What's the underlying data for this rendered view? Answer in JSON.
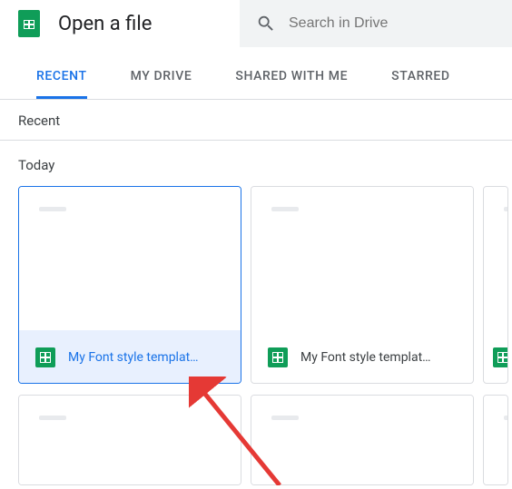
{
  "header": {
    "title": "Open a file",
    "search": {
      "placeholder": "Search in Drive",
      "value": ""
    }
  },
  "tabs": {
    "items": [
      {
        "label": "RECENT",
        "active": true
      },
      {
        "label": "MY DRIVE",
        "active": false
      },
      {
        "label": "SHARED WITH ME",
        "active": false
      },
      {
        "label": "STARRED",
        "active": false
      }
    ]
  },
  "section": {
    "label": "Recent"
  },
  "group": {
    "label": "Today"
  },
  "files": {
    "row1": [
      {
        "name": "My Font style templat…",
        "selected": true
      },
      {
        "name": "My Font style templat…",
        "selected": false
      }
    ]
  },
  "colors": {
    "accent": "#1a73e8",
    "sheets": "#0f9d58"
  }
}
